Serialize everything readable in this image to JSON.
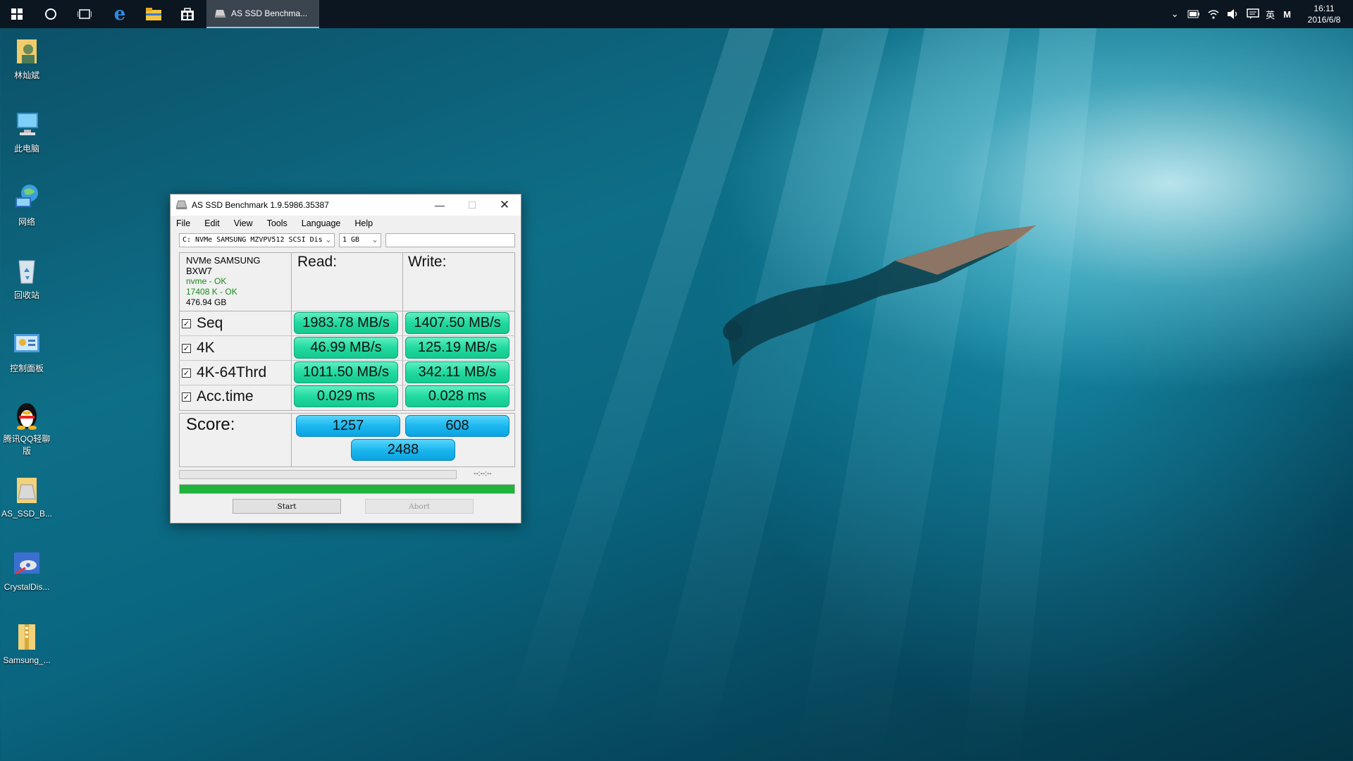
{
  "taskbar": {
    "active_app_label": "AS SSD Benchma...",
    "tray": {
      "ime": "英",
      "m": "M",
      "time": "16:11",
      "date": "2016/6/8"
    }
  },
  "desktop_icons": [
    {
      "label": "林灿斌",
      "icon": "user-folder-icon"
    },
    {
      "label": "此电脑",
      "icon": "computer-icon"
    },
    {
      "label": "网络",
      "icon": "network-icon"
    },
    {
      "label": "回收站",
      "icon": "recycle-bin-icon"
    },
    {
      "label": "控制面板",
      "icon": "control-panel-icon"
    },
    {
      "label": "腾讯QQ轻聊版",
      "icon": "qq-penguin-icon"
    },
    {
      "label": "AS_SSD_B...",
      "icon": "as-ssd-icon"
    },
    {
      "label": "CrystalDis...",
      "icon": "crystaldisk-icon"
    },
    {
      "label": "Samsung_...",
      "icon": "zip-folder-icon"
    }
  ],
  "window": {
    "title": "AS SSD Benchmark 1.9.5986.35387",
    "menu": [
      "File",
      "Edit",
      "View",
      "Tools",
      "Language",
      "Help"
    ],
    "drive_select": "C: NVMe SAMSUNG MZVPV512 SCSI Dis",
    "size_select": "1 GB",
    "search_value": "",
    "drive_info": {
      "model": "NVMe SAMSUNG",
      "firmware": "BXW7",
      "driver": "nvme - OK",
      "alignment": "17408 K - OK",
      "capacity": "476.94 GB"
    },
    "read_header": "Read:",
    "write_header": "Write:",
    "rows": [
      {
        "label": "Seq",
        "read": "1983.78 MB/s",
        "write": "1407.50 MB/s"
      },
      {
        "label": "4K",
        "read": "46.99 MB/s",
        "write": "125.19 MB/s"
      },
      {
        "label": "4K-64Thrd",
        "read": "1011.50 MB/s",
        "write": "342.11 MB/s"
      },
      {
        "label": "Acc.time",
        "read": "0.029 ms",
        "write": "0.028 ms"
      }
    ],
    "score_label": "Score:",
    "score_read": "1257",
    "score_write": "608",
    "score_total": "2488",
    "elapsed": "--:--:--",
    "progress": 1.0,
    "start_label": "Start",
    "abort_label": "Abort",
    "colors": {
      "result_green": "#22d9a0",
      "score_blue": "#1cb7ef",
      "progress_green": "#1fb33c"
    }
  }
}
